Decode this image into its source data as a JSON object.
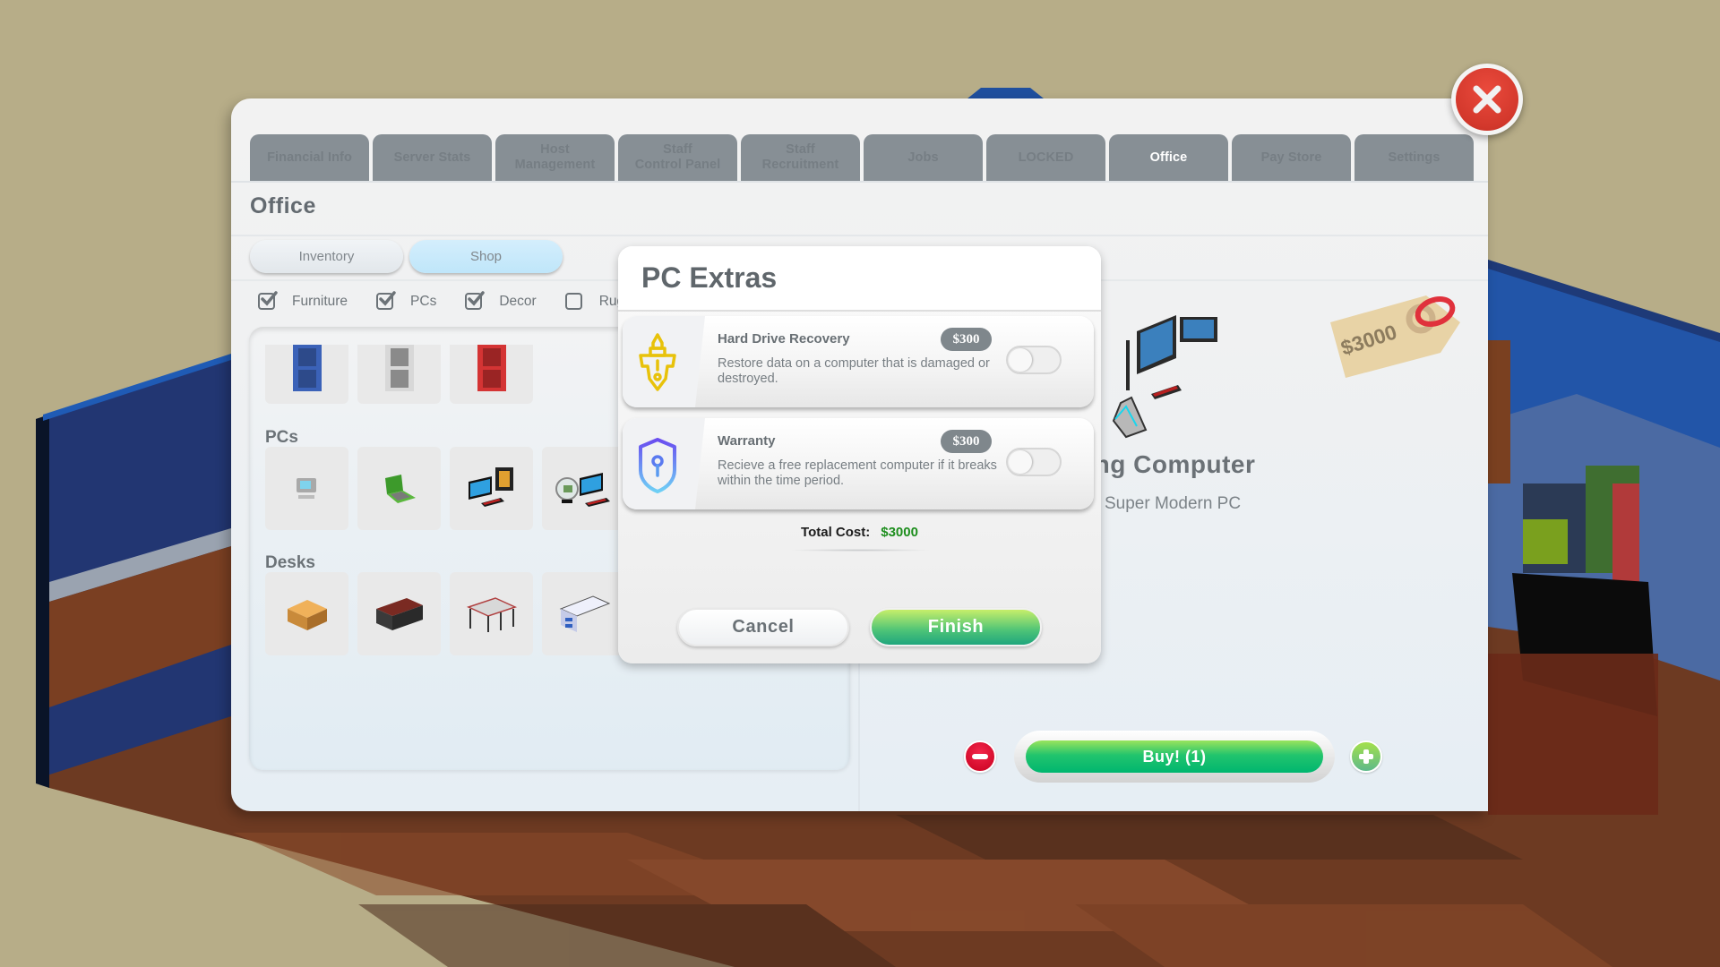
{
  "window": {
    "tabs": [
      {
        "label": "Financial Info",
        "active": false
      },
      {
        "label": "Server Stats",
        "active": false
      },
      {
        "label": "Host\nManagement",
        "active": false
      },
      {
        "label": "Staff\nControl Panel",
        "active": false
      },
      {
        "label": "Staff\nRecruitment",
        "active": false
      },
      {
        "label": "Jobs",
        "active": false
      },
      {
        "label": "LOCKED",
        "active": false
      },
      {
        "label": "Office",
        "active": true
      },
      {
        "label": "Pay Store",
        "active": false
      },
      {
        "label": "Settings",
        "active": false
      }
    ],
    "page_title": "Office",
    "segments": {
      "inventory": "Inventory",
      "shop": "Shop",
      "selected": "Shop"
    },
    "filters": [
      {
        "label": "Furniture",
        "checked": true
      },
      {
        "label": "PCs",
        "checked": true
      },
      {
        "label": "Decor",
        "checked": true
      },
      {
        "label": "Rugs",
        "checked": false
      }
    ]
  },
  "shop": {
    "categories": [
      {
        "label": "",
        "items": [
          "blue-cabinet",
          "white-cabinet",
          "red-cabinet"
        ]
      },
      {
        "label": "PCs",
        "items": [
          "basic-pc",
          "green-laptop",
          "dual-monitor-pc",
          "gaming-computer"
        ]
      },
      {
        "label": "Desks",
        "items": [
          "wooden-desk",
          "executive-desk",
          "corner-desk",
          "modern-white-desk"
        ]
      }
    ]
  },
  "product": {
    "name_visible": "ming Computer",
    "subtitle": "Super Modern PC",
    "price_tag": "$3000"
  },
  "purchase": {
    "quantity": 1,
    "buy_label": "Buy! (1)"
  },
  "dialog": {
    "title": "PC Extras",
    "extras": [
      {
        "name": "Hard Drive Recovery",
        "price": "$300",
        "description": "Restore data on a computer that is damaged or destroyed.",
        "enabled": false,
        "icon": "usb-drive-icon"
      },
      {
        "name": "Warranty",
        "price": "$300",
        "description": "Recieve a free replacement computer if it breaks within the time period.",
        "enabled": false,
        "icon": "shield-key-icon"
      }
    ],
    "total_label": "Total Cost:",
    "total_value": "$3000",
    "cancel_label": "Cancel",
    "finish_label": "Finish"
  },
  "colors": {
    "accent_green": "#1d8e1d",
    "close_red": "#d3382c",
    "tab_gray": "#878f95",
    "icon_yellow": "#e8c20a",
    "icon_blue": "#6f5cf2"
  }
}
